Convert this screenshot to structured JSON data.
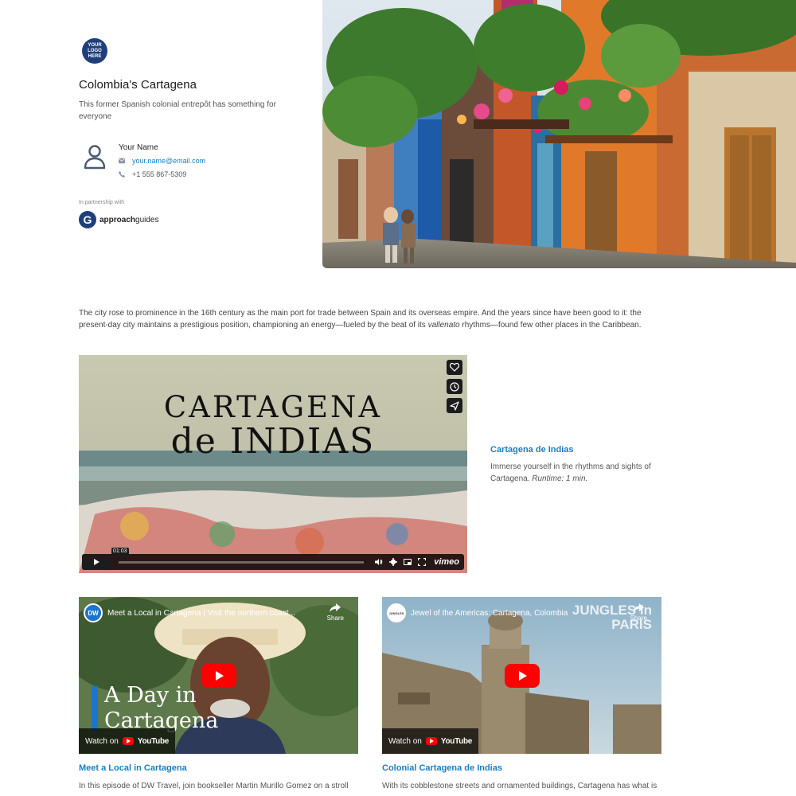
{
  "header": {
    "logo_text": "YOUR LOGO HERE",
    "title": "Colombia's Cartagena",
    "subtitle": "This former Spanish colonial entrepôt has something for everyone"
  },
  "contact": {
    "name": "Your Name",
    "email": "your.name@email.com",
    "phone": "+1 555 867-5309",
    "icons": [
      "person-icon",
      "mail-icon",
      "phone-icon"
    ]
  },
  "partner": {
    "label": "In partnership with",
    "brand_bold": "approach",
    "brand_rest": "guides"
  },
  "intro": {
    "before_italic": "The city rose to prominence in the 16th century as the main port for trade between Spain and its overseas empire. And the years since have been good to it: the present-day city maintains a prestigious position, championing an energy—fueled by the beat of its ",
    "italic": "vallenato",
    "after_italic": " rhythms—found few other places in the Caribbean."
  },
  "main_video": {
    "overlay_line1": "CARTAGENA",
    "overlay_line2": "de INDIAS",
    "time": "01:03",
    "brand": "vimeo",
    "title": "Cartagena de Indias",
    "desc": "Immerse yourself in the rhythms and sights of Cartagena.",
    "runtime": "Runtime: 1 min."
  },
  "video_cards": [
    {
      "channel": "DW",
      "yt_title": "Meet a Local in Cartagena | Visit the northern coast...",
      "share": "Share",
      "overlay": "A Day in Cartagena",
      "watch_on": "Watch on",
      "yt_brand": "YouTube",
      "title": "Meet a Local in Cartagena",
      "desc": "In this episode of DW Travel, join bookseller Martin Murillo Gomez on a stroll"
    },
    {
      "channel": "JUNGLES",
      "yt_title": "Jewel of the Americas: Cartagena, Colombia",
      "share": "Share",
      "watermark": "JUNGLES in PARIS",
      "watch_on": "Watch on",
      "yt_brand": "YouTube",
      "title": "Colonial Cartagena de Indias",
      "desc": "With its cobblestone streets and ornamented buildings, Cartagena has what is"
    }
  ],
  "colors": {
    "accent": "#1a7fc1",
    "brand_dark": "#1f3f7a",
    "youtube_red": "#ff0000"
  }
}
